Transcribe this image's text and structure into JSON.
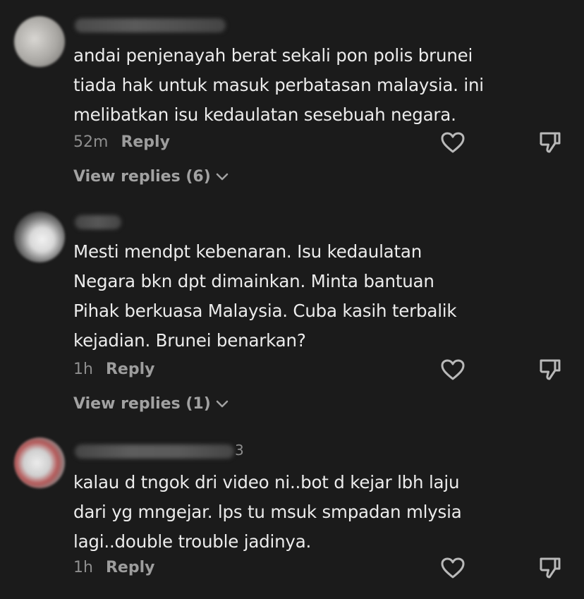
{
  "comments": [
    {
      "username_tail": "",
      "text_lines": [
        "andai penjenayah berat sekali pon polis brunei",
        "tiada hak untuk masuk perbatasan malaysia. ini",
        "melibatkan isu kedaulatan sesebuah negara."
      ],
      "time": "52m",
      "reply_label": "Reply",
      "view_replies": "View replies (6)"
    },
    {
      "username_tail": "",
      "text_lines": [
        "Mesti mendpt kebenaran. Isu kedaulatan",
        "Negara bkn dpt dimainkan. Minta bantuan",
        "Pihak berkuasa Malaysia. Cuba kasih terbalik",
        "kejadian. Brunei benarkan?"
      ],
      "time": "1h",
      "reply_label": "Reply",
      "view_replies": "View replies (1)"
    },
    {
      "username_tail": "3",
      "text_lines": [
        "kalau d tngok dri video ni..bot d kejar lbh laju",
        "dari yg mngejar. lps tu msuk smpadan mlysia",
        "lagi..double trouble jadinya."
      ],
      "time": "1h",
      "reply_label": "Reply",
      "view_replies": ""
    }
  ],
  "icons": {
    "like": "heart-outline-icon",
    "dislike": "thumbs-down-icon",
    "expand": "chevron-down-icon"
  },
  "colors": {
    "background": "#1b1b1b",
    "text": "#ececec",
    "muted": "#8e8e8e"
  }
}
